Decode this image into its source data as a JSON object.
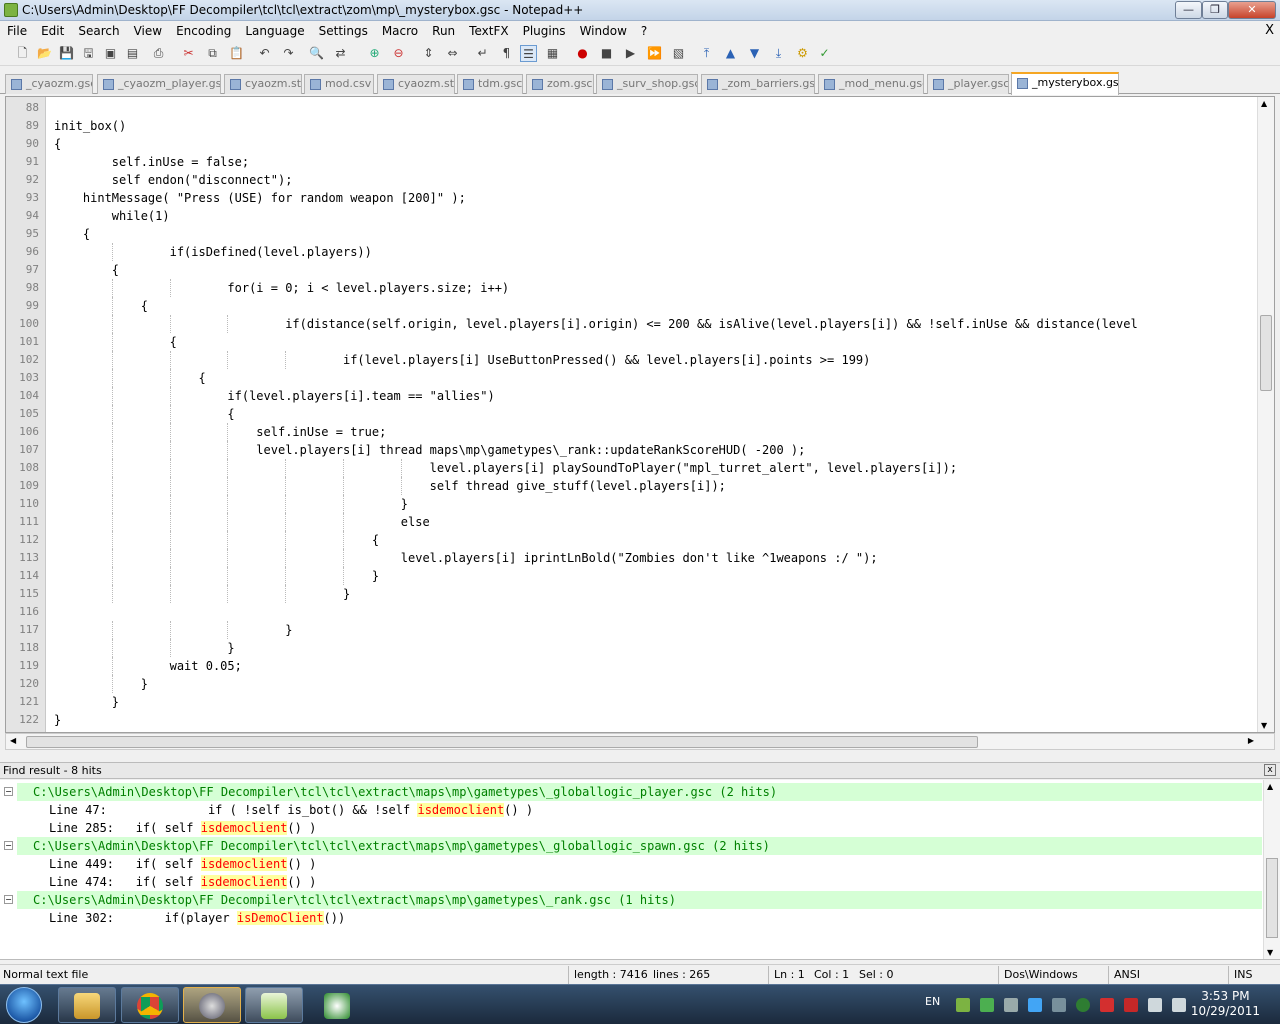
{
  "window": {
    "title": "C:\\Users\\Admin\\Desktop\\FF Decompiler\\tcl\\tcl\\extract\\zom\\mp\\_mysterybox.gsc - Notepad++",
    "btn_min": "—",
    "btn_max": "❐",
    "btn_close": "✕"
  },
  "menu": [
    "File",
    "Edit",
    "Search",
    "View",
    "Encoding",
    "Language",
    "Settings",
    "Macro",
    "Run",
    "TextFX",
    "Plugins",
    "Window",
    "?"
  ],
  "menu_close": "X",
  "tabs": [
    "_cyaozm.gsc",
    "_cyaozm_player.gsc",
    "cyaozm.str",
    "mod.csv",
    "cyaozm.str",
    "tdm.gsc",
    "zom.gsc",
    "_surv_shop.gsc",
    "_zom_barriers.gsc",
    "_mod_menu.gsc",
    "_player.gsc",
    "_mysterybox.gsc"
  ],
  "editor": {
    "line_numbers": [
      "88",
      "89",
      "90",
      "91",
      "92",
      "93",
      "94",
      "95",
      "96",
      "97",
      "98",
      "99",
      "100",
      "101",
      "102",
      "103",
      "104",
      "105",
      "106",
      "107",
      "108",
      "109",
      "110",
      "111",
      "112",
      "113",
      "114",
      "115",
      "116",
      "117",
      "118",
      "119",
      "120",
      "121",
      "122"
    ],
    "lines": [
      "",
      "init_box()",
      "{",
      "        self.inUse = false;",
      "        self endon(\"disconnect\");",
      "    hintMessage( \"Press (USE) for random weapon [200]\" );",
      "        while(1)",
      "    {",
      "                if(isDefined(level.players))",
      "        {",
      "                        for(i = 0; i < level.players.size; i++)",
      "            {",
      "                                if(distance(self.origin, level.players[i].origin) <= 200 && isAlive(level.players[i]) && !self.inUse && distance(level",
      "                {",
      "                                        if(level.players[i] UseButtonPressed() && level.players[i].points >= 199)",
      "                    {",
      "                        if(level.players[i].team == \"allies\")",
      "                        {",
      "                            self.inUse = true;",
      "                            level.players[i] thread maps\\mp\\gametypes\\_rank::updateRankScoreHUD( -200 );",
      "                                                    level.players[i] playSoundToPlayer(\"mpl_turret_alert\", level.players[i]);",
      "                                                    self thread give_stuff(level.players[i]);",
      "                                                }",
      "                                                else",
      "                                            {",
      "                                                level.players[i] iprintLnBold(\"Zombies don't like ^1weapons :/ \");",
      "                                            }",
      "                                        }",
      "",
      "                                }",
      "                        }",
      "                wait 0.05;",
      "            }",
      "        }",
      "}"
    ]
  },
  "find": {
    "header": "Find result - 8 hits",
    "close": "x",
    "rows": [
      {
        "type": "file",
        "text": "C:\\Users\\Admin\\Desktop\\FF Decompiler\\tcl\\tcl\\extract\\maps\\mp\\gametypes\\_globallogic_player.gsc (2 hits)"
      },
      {
        "type": "line",
        "pre": "Line 47:              if ( !self is_bot() && !self ",
        "hit": "isdemoclient",
        "post": "() )"
      },
      {
        "type": "line",
        "pre": "Line 285:   if( self ",
        "hit": "isdemoclient",
        "post": "() )"
      },
      {
        "type": "file",
        "text": "C:\\Users\\Admin\\Desktop\\FF Decompiler\\tcl\\tcl\\extract\\maps\\mp\\gametypes\\_globallogic_spawn.gsc (2 hits)"
      },
      {
        "type": "line",
        "pre": "Line 449:   if( self ",
        "hit": "isdemoclient",
        "post": "() )"
      },
      {
        "type": "line",
        "pre": "Line 474:   if( self ",
        "hit": "isdemoclient",
        "post": "() )"
      },
      {
        "type": "file",
        "text": "C:\\Users\\Admin\\Desktop\\FF Decompiler\\tcl\\tcl\\extract\\maps\\mp\\gametypes\\_rank.gsc (1 hits)"
      },
      {
        "type": "line",
        "pre": "Line 302:       if(player ",
        "hit": "isDemoClient",
        "post": "())"
      }
    ]
  },
  "status": {
    "filetype": "Normal text file",
    "length": "length : 7416",
    "lines": "lines : 265",
    "ln": "Ln : 1",
    "col": "Col : 1",
    "sel": "Sel : 0",
    "eol": "Dos\\Windows",
    "encoding": "ANSI",
    "mode": "INS"
  },
  "taskbar": {
    "lang": "EN",
    "time": "3:53 PM",
    "date": "10/29/2011"
  },
  "colors": {
    "find_file_bg": "#d5ffd5",
    "find_file_fg": "#008000",
    "hit_bg": "#ffff9f",
    "hit_fg": "#ff0000",
    "active_tab_accent": "#f5a623"
  }
}
